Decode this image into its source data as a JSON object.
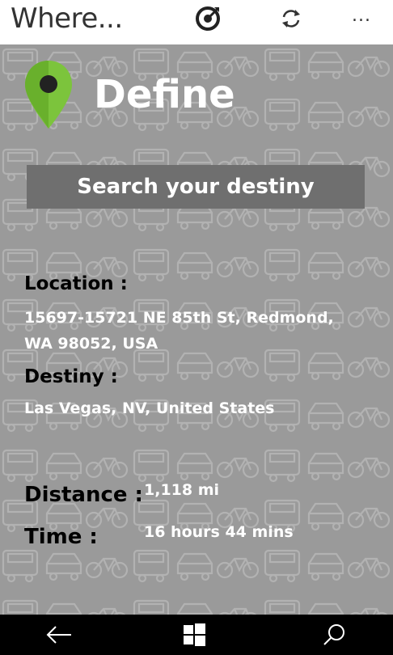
{
  "app": {
    "title": "Where..."
  },
  "toolbar": {
    "icons": [
      "target-icon",
      "refresh-icon",
      "more-icon"
    ],
    "more_label": "..."
  },
  "header": {
    "title": "Define"
  },
  "search": {
    "button_label": "Search your destiny"
  },
  "route": {
    "location_label": "Location :",
    "location_value": "15697-15721 NE 85th St, Redmond, WA 98052, USA",
    "destiny_label": "Destiny :",
    "destiny_value": "Las Vegas, NV, United States",
    "distance_label": "Distance :",
    "distance_value": "1,118 mi",
    "time_label": "Time :",
    "time_value": "16 hours 44 mins"
  },
  "nav": {
    "icons": [
      "back-arrow-icon",
      "windows-icon",
      "search-icon"
    ]
  },
  "colors": {
    "background": "#9a9a9a",
    "pattern": "#b4b4b4",
    "button": "#6f6f6f",
    "pin_green": "#79c23a",
    "navbar": "#000000"
  }
}
